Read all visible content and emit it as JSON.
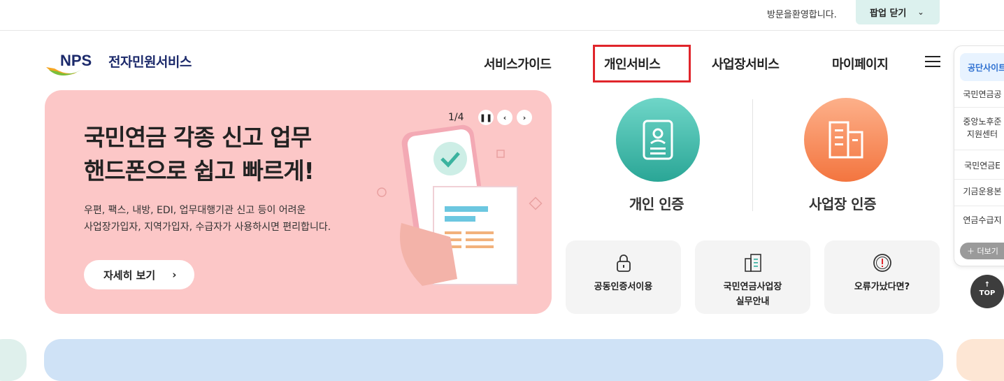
{
  "topbar": {
    "welcome": "방문을환영합니다.",
    "popup_close_label": "팝업 닫기"
  },
  "brand": {
    "logo_mark": "NPS",
    "service_name": "전자민원서비스"
  },
  "gnb": {
    "items": [
      {
        "label": "서비스가이드"
      },
      {
        "label": "개인서비스",
        "highlighted": true
      },
      {
        "label": "사업장서비스"
      },
      {
        "label": "마이페이지"
      }
    ]
  },
  "banner": {
    "title": "국민연금 각종 신고 업무\n핸드폰으로 쉽고 빠르게!",
    "description": "우편, 팩스, 내방, EDI, 업무대행기관 신고 등이 어려운\n사업장가입자, 지역가입자, 수급자가 사용하시면 편리합니다.",
    "detail_button": "자세히 보기",
    "pager": "1/4",
    "background": "#fcc7c7"
  },
  "auth": {
    "personal": {
      "label": "개인 인증",
      "icon": "id-card-icon",
      "color": "#2fae9e"
    },
    "business": {
      "label": "사업장 인증",
      "icon": "building-icon",
      "color": "#f58b55"
    }
  },
  "services": [
    {
      "label": "공동인증서이용",
      "icon": "lock-icon"
    },
    {
      "label": "국민연금사업장\n실무안내",
      "icon": "document-icon"
    },
    {
      "label": "오류가났다면?",
      "icon": "alert-icon"
    }
  ],
  "side_panel": {
    "head": "공단사이트",
    "items": [
      {
        "label": "국민연금공"
      },
      {
        "label": "중앙노후준\n지원센터"
      },
      {
        "label": "국민연금E"
      },
      {
        "label": "기금운용본"
      },
      {
        "label": "연금수급지"
      }
    ],
    "more": "더보기"
  },
  "top_button": "TOP",
  "colors": {
    "accent_highlight": "#e0252b",
    "strip_blue": "#cfe2f6",
    "strip_mint": "#dff0ec",
    "strip_peach": "#fde6d4"
  }
}
